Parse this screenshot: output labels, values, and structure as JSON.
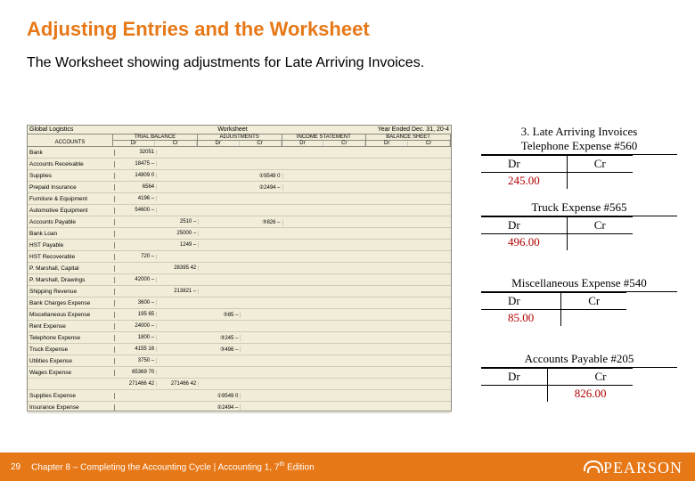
{
  "title": "Adjusting Entries and the Worksheet",
  "subtitle": "The Worksheet showing adjustments for Late Arriving Invoices.",
  "worksheet": {
    "company": "Global Logistics",
    "label": "Worksheet",
    "period": "Year Ended Dec. 31, 20-4",
    "acctHead": "ACCOUNTS",
    "sections": [
      "TRIAL BALANCE",
      "ADJUSTMENTS",
      "INCOME STATEMENT",
      "BALANCE SHEET"
    ],
    "drcr": [
      "Dr",
      "Cr"
    ],
    "rows": [
      {
        "a": "Bank",
        "tbdr": "32051"
      },
      {
        "a": "Accounts Receivable",
        "tbdr": "18475 –"
      },
      {
        "a": "Supplies",
        "tbdr": "14809 0",
        "adcr": "①9549 0"
      },
      {
        "a": "Prepaid Insurance",
        "tbdr": "6564",
        "adcr": "②2494 –"
      },
      {
        "a": "Furniture & Equipment",
        "tbdr": "4196 –"
      },
      {
        "a": "Automotive Equipment",
        "tbdr": "54600 –"
      },
      {
        "a": "Accounts Payable",
        "tbcr": "2510 –",
        "adcr": "③826 –"
      },
      {
        "a": "Bank Loan",
        "tbcr": "25000 –"
      },
      {
        "a": "HST Payable",
        "tbcr": "1249 –"
      },
      {
        "a": "HST Recoverable",
        "tbdr": "720 –"
      },
      {
        "a": "P. Marshall, Capital",
        "tbcr": "28395 42"
      },
      {
        "a": "P. Marshall, Drawings",
        "tbdr": "42000 –"
      },
      {
        "a": "Shipping Revenue",
        "tbcr": "213821 –"
      },
      {
        "a": "Bank Charges Expense",
        "tbdr": "3600 –"
      },
      {
        "a": "Miscellaneous Expense",
        "tbdr": "195 65",
        "addr": "③85 –"
      },
      {
        "a": "Rent Expense",
        "tbdr": "24000 –"
      },
      {
        "a": "Telephone Expense",
        "tbdr": "1800 –",
        "addr": "③245 –"
      },
      {
        "a": "Truck Expense",
        "tbdr": "4155 16",
        "addr": "③496 –"
      },
      {
        "a": "Utilities Expense",
        "tbdr": "3750 –"
      },
      {
        "a": "Wages Expense",
        "tbdr": "65369 70"
      },
      {
        "a": "",
        "tbdr": "271466 42",
        "tbcr": "271466 42"
      },
      {
        "a": "Supplies Expense",
        "addr": "①9549 0"
      },
      {
        "a": "Insurance Expense",
        "addr": "②2494 –"
      }
    ]
  },
  "ledgers": {
    "sectionTitle": "3. Late Arriving Invoices",
    "dr": "Dr",
    "cr": "Cr",
    "items": [
      {
        "title": "Telephone Expense #560",
        "drval": "245.00",
        "crval": ""
      },
      {
        "title": "Truck Expense #565",
        "drval": "496.00",
        "crval": ""
      },
      {
        "title": "Miscellaneous Expense #540",
        "drval": "85.00",
        "crval": ""
      },
      {
        "title": "Accounts Payable #205",
        "drval": "",
        "crval": "826.00"
      }
    ]
  },
  "footer": {
    "page": "29",
    "text": "Chapter 8 – Completing the Accounting Cycle | Accounting 1, 7",
    "sup": "th",
    "text2": " Edition",
    "brand": "PEARSON"
  }
}
